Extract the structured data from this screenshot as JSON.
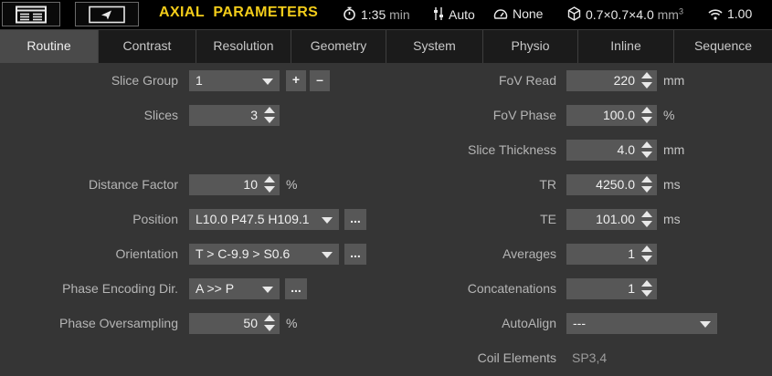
{
  "header": {
    "title": "AXIAL  PARAMETERS",
    "time": "1:35",
    "time_unit": "min",
    "mode": "Auto",
    "gating": "None",
    "voxel_size": "0.7×0.7×4.0",
    "voxel_unit": "mm",
    "voxel_exp": "3",
    "snr": "1.00",
    "icons": {
      "menu": "list-menu-icon",
      "send": "send-icon",
      "time": "stopwatch-icon",
      "mode": "tuning-icon",
      "gating": "gauge-icon",
      "voxel": "cube-icon",
      "snr": "signal-icon"
    }
  },
  "tabs": [
    "Routine",
    "Contrast",
    "Resolution",
    "Geometry",
    "System",
    "Physio",
    "Inline",
    "Sequence"
  ],
  "active_tab": "Routine",
  "left": {
    "slice_group": {
      "label": "Slice Group",
      "value": "1",
      "plus": "+",
      "minus": "–"
    },
    "slices": {
      "label": "Slices",
      "value": "3"
    },
    "distance_factor": {
      "label": "Distance Factor",
      "value": "10",
      "unit": "%"
    },
    "position": {
      "label": "Position",
      "value": "L10.0 P47.5 H109.1",
      "more": "..."
    },
    "orientation": {
      "label": "Orientation",
      "value": "T > C-9.9 > S0.6",
      "more": "..."
    },
    "phase_encoding_dir": {
      "label": "Phase Encoding Dir.",
      "value": "A >> P",
      "more": "..."
    },
    "phase_oversampling": {
      "label": "Phase Oversampling",
      "value": "50",
      "unit": "%"
    }
  },
  "right": {
    "fov_read": {
      "label": "FoV Read",
      "value": "220",
      "unit": "mm"
    },
    "fov_phase": {
      "label": "FoV Phase",
      "value": "100.0",
      "unit": "%"
    },
    "slice_thickness": {
      "label": "Slice Thickness",
      "value": "4.0",
      "unit": "mm"
    },
    "tr": {
      "label": "TR",
      "value": "4250.0",
      "unit": "ms"
    },
    "te": {
      "label": "TE",
      "value": "101.00",
      "unit": "ms"
    },
    "averages": {
      "label": "Averages",
      "value": "1"
    },
    "concatenations": {
      "label": "Concatenations",
      "value": "1"
    },
    "autoalign": {
      "label": "AutoAlign",
      "value": "---"
    },
    "coil_elements": {
      "label": "Coil Elements",
      "value": "SP3,4"
    }
  },
  "colors": {
    "title": "#f2cc1a",
    "background": "#353535",
    "field": "#575757",
    "active_tab": "#4a4a4a"
  }
}
